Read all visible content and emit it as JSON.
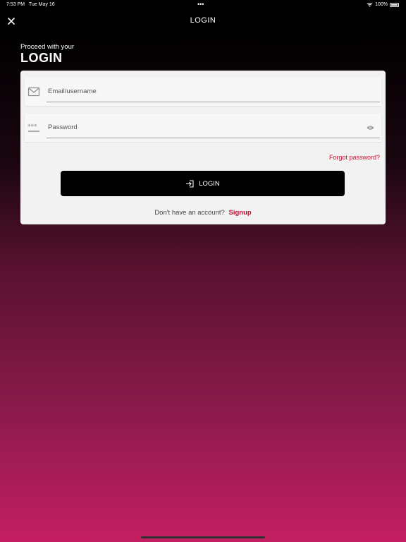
{
  "status_bar": {
    "time": "7:53 PM",
    "date": "Tue May 16",
    "dots": "•••",
    "battery": "100%"
  },
  "nav": {
    "title": "LOGIN",
    "close_icon": "close-icon"
  },
  "heading": {
    "subtitle": "Proceed with your",
    "title": "LOGIN"
  },
  "form": {
    "email": {
      "placeholder": "Email/username",
      "value": "",
      "icon": "mail-icon"
    },
    "password": {
      "placeholder": "Password",
      "value": "",
      "icon": "password-dots-icon",
      "toggle_icon": "eye-icon"
    },
    "forgot_label": "Forgot password?",
    "login_label": "LOGIN",
    "login_icon": "login-arrow-icon",
    "signup_prompt": "Don't have an account?",
    "signup_label": "Signup"
  },
  "colors": {
    "accent": "#c8102e",
    "button_bg": "#000000",
    "gradient_bottom": "#c41e62"
  }
}
